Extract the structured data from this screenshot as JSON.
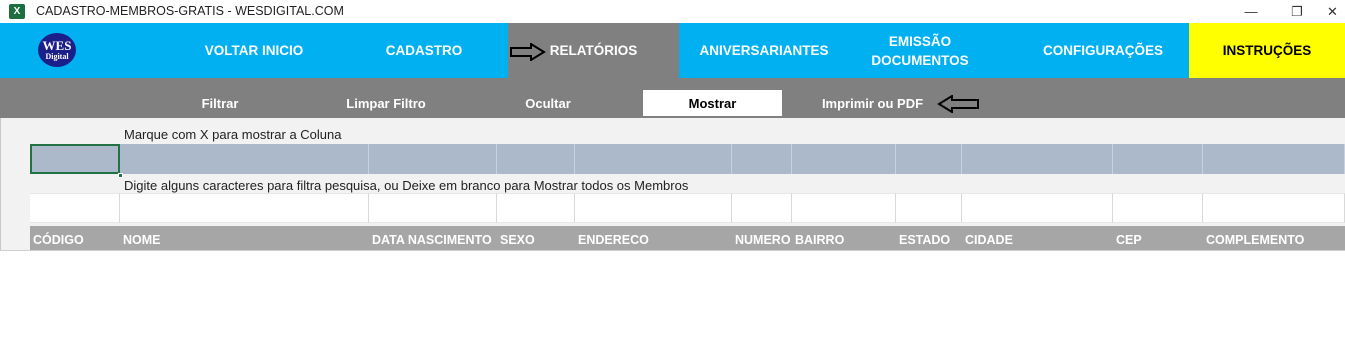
{
  "window": {
    "app_icon": "excel-icon",
    "title": "CADASTRO-MEMBROS-GRATIS - WESDIGITAL.COM",
    "minimize_glyph": "—",
    "restore_glyph": "❐",
    "close_glyph": "✕"
  },
  "logo": {
    "line1": "WES",
    "line2": "Digital"
  },
  "nav": {
    "items": [
      {
        "label": "VOLTAR INICIO"
      },
      {
        "label": "CADASTRO"
      },
      {
        "label": "RELATÓRIOS"
      },
      {
        "label": "ANIVERSARIANTES"
      },
      {
        "label": "EMISSÃO DOCUMENTOS"
      },
      {
        "label": "CONFIGURAÇÕES"
      },
      {
        "label": "INSTRUÇÕES"
      }
    ],
    "active": "RELATÓRIOS"
  },
  "actions": {
    "items": [
      {
        "label": "Filtrar"
      },
      {
        "label": "Limpar Filtro"
      },
      {
        "label": "Ocultar"
      },
      {
        "label": "Mostrar"
      },
      {
        "label": "Imprimir ou PDF"
      }
    ],
    "active": "Mostrar"
  },
  "instructions": {
    "show_columns": "Marque com X para mostrar a Coluna",
    "filter_hint": "Digite alguns caracteres para filtra pesquisa, ou Deixe em branco para Mostrar todos os Membros"
  },
  "columns": [
    "CÓDIGO",
    "NOME",
    "DATA NASCIMENTO",
    "SEXO",
    "ENDERECO",
    "NUMERO",
    "BAIRRO",
    "ESTADO",
    "CIDADE",
    "CEP",
    "COMPLEMENTO"
  ],
  "colors": {
    "nav_bg": "#00b0f0",
    "nav_active": "#808080",
    "instructions_bg": "#ffff00",
    "checkbox_row": "#acb9ca",
    "header_bg": "#a6a6a6"
  }
}
